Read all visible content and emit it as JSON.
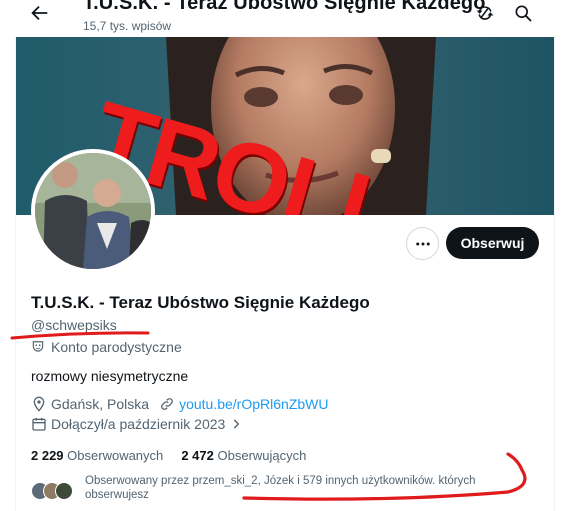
{
  "header": {
    "title": "T.U.S.K. - Teraz Ubóstwo Sięgnie Każdego",
    "subtitle": "15,7 tys. wpisów",
    "back_icon": "arrow-left-icon",
    "icons": [
      "refresh-icon",
      "search-icon"
    ]
  },
  "banner": {
    "overlay_text": "TROLL",
    "overlay_color": "#ee1c1c"
  },
  "actions": {
    "more_icon": "more-dots-icon",
    "follow_label": "Obserwuj"
  },
  "profile": {
    "name": "T.U.S.K. - Teraz Ubóstwo Sięgnie Każdego",
    "handle": "@schwepsiks",
    "parody_label": "Konto parodystyczne",
    "bio": "rozmowy niesymetryczne",
    "location": "Gdańsk, Polska",
    "link": "youtu.be/rOpRl6nZbWU",
    "joined": "Dołączył/a październik 2023"
  },
  "stats": {
    "following_count": "2 229",
    "following_label": "Obserwowanych",
    "followers_count": "2 472",
    "followers_label": "Obserwujących"
  },
  "followed_by": {
    "text": "Obserwowany przez przem_ski_2, Józek i 579 innych użytkowników. których obserwujesz"
  },
  "colors": {
    "accent": "#1d9bf0",
    "annotation_red": "#e01b1b",
    "button_dark": "#0f1419"
  }
}
